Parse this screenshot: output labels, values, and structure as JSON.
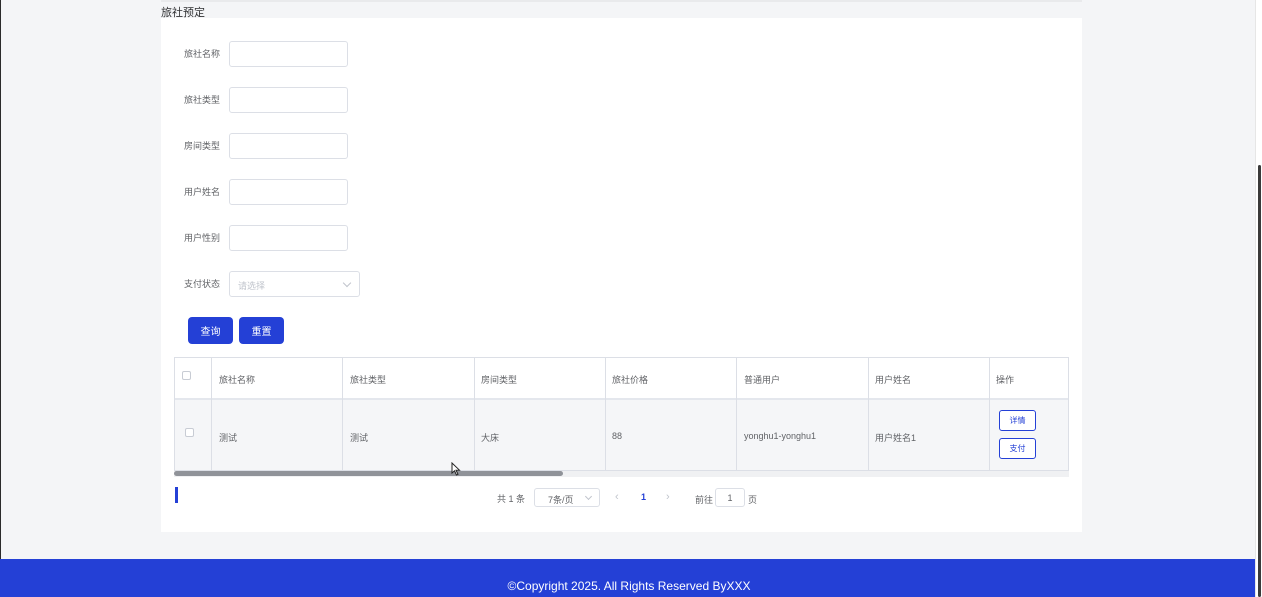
{
  "page_title": "旅社预定",
  "form": {
    "fields": [
      {
        "label": "旅社名称",
        "value": ""
      },
      {
        "label": "旅社类型",
        "value": ""
      },
      {
        "label": "房间类型",
        "value": ""
      },
      {
        "label": "用户姓名",
        "value": ""
      },
      {
        "label": "用户性别",
        "value": ""
      }
    ],
    "pay_status": {
      "label": "支付状态",
      "placeholder": "请选择"
    },
    "buttons": {
      "query": "查询",
      "reset": "重置"
    }
  },
  "table": {
    "columns": [
      "旅社名称",
      "旅社类型",
      "房间类型",
      "旅社价格",
      "普通用户",
      "用户姓名",
      "操作"
    ],
    "rows": [
      {
        "name": "测试",
        "type": "测试",
        "room_type": "大床",
        "price": "88",
        "user": "yonghu1-yonghu1",
        "user_name": "用户姓名1",
        "actions": {
          "detail": "详情",
          "pay": "支付"
        }
      }
    ]
  },
  "pagination": {
    "total": "共 1 条",
    "page_size": "7条/页",
    "current_page": "1",
    "goto_prefix": "前往",
    "goto_value": "1",
    "goto_suffix": "页"
  },
  "footer": {
    "text": "©Copyright 2025. All Rights Reserved ByXXX"
  },
  "colors": {
    "primary": "#2440d6",
    "background": "#f4f5f7"
  }
}
